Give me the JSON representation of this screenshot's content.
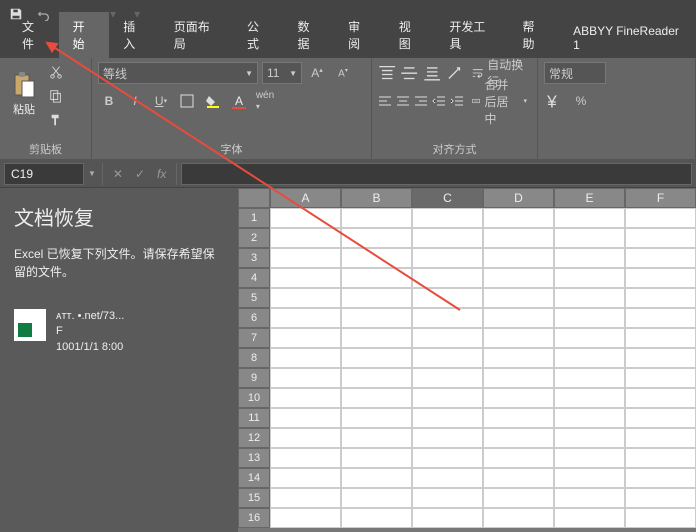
{
  "titlebar": {
    "save": "save",
    "undo": "undo",
    "redo": "redo"
  },
  "tabs": [
    "文件",
    "开始",
    "插入",
    "页面布局",
    "公式",
    "数据",
    "审阅",
    "视图",
    "开发工具",
    "帮助",
    "ABBYY FineReader 1"
  ],
  "activeTab": 1,
  "ribbon": {
    "clipboard": {
      "paste": "粘贴",
      "label": "剪贴板"
    },
    "font": {
      "name": "等线",
      "size": "11",
      "label": "字体",
      "bold": "B",
      "italic": "I",
      "underline": "U"
    },
    "align": {
      "label": "对齐方式",
      "wrap": "自动换行",
      "merge": "合并后居中"
    },
    "number": {
      "label": "",
      "format": "常规",
      "percent": "%"
    }
  },
  "formula": {
    "cell": "C19",
    "fx": "fx"
  },
  "recovery": {
    "title": "文档恢复",
    "msg": "Excel 已恢复下列文件。请保存希望保留的文件。",
    "items": [
      {
        "l1": "ᴀᴛᴛ.           •.net/73...",
        "l2": "F                          ",
        "l3": "1001/1/1 8:00"
      }
    ]
  },
  "cols": [
    "A",
    "B",
    "C",
    "D",
    "E",
    "F"
  ],
  "rowcount": 16,
  "activeCol": 2
}
